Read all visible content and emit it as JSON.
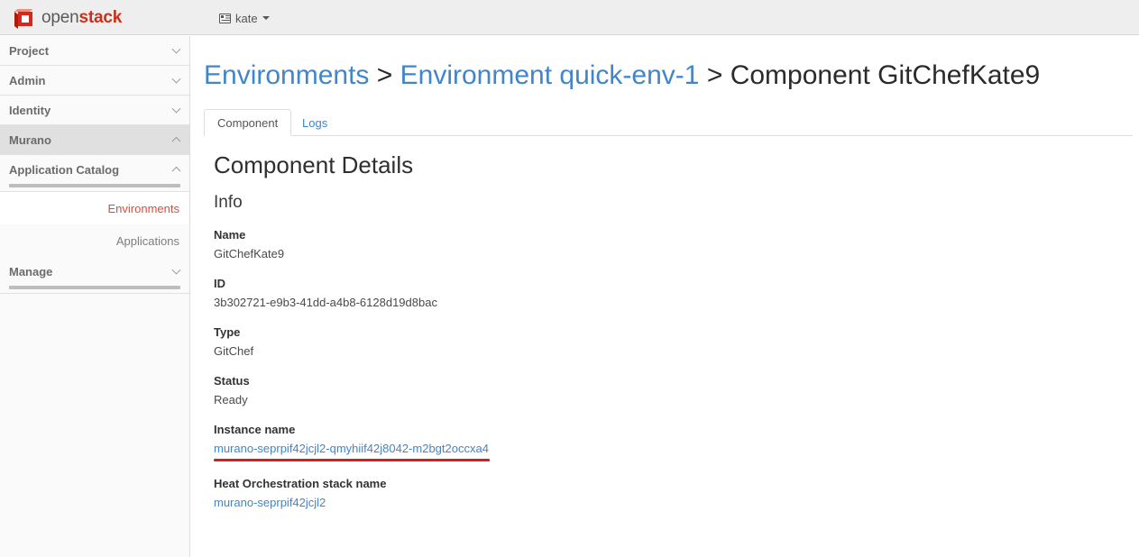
{
  "navbar": {
    "brand_open": "open",
    "brand_stack": "stack",
    "brand_logo_icon": "openstack-cube-icon",
    "user_icon": "id-card-icon",
    "user_name": "kate",
    "caret_icon": "caret-down-icon"
  },
  "sidebar": {
    "groups": [
      {
        "label": "Project",
        "state": "collapsed",
        "chevron": "chevron-down-icon"
      },
      {
        "label": "Admin",
        "state": "collapsed",
        "chevron": "chevron-down-icon"
      },
      {
        "label": "Identity",
        "state": "collapsed",
        "chevron": "chevron-down-icon"
      },
      {
        "label": "Murano",
        "state": "expanded",
        "chevron": "chevron-up-icon"
      },
      {
        "label": "Application Catalog",
        "state": "expanded",
        "chevron": "chevron-up-icon"
      },
      {
        "label": "Manage",
        "state": "collapsed",
        "chevron": "chevron-down-icon"
      }
    ],
    "items": [
      {
        "label": "Environments",
        "current": true
      },
      {
        "label": "Applications",
        "current": false
      }
    ]
  },
  "breadcrumb": {
    "root": "Environments",
    "sep": ">",
    "environment": "Environment quick-env-1",
    "current": "Component GitChefKate9"
  },
  "tabs": [
    {
      "label": "Component",
      "active": true
    },
    {
      "label": "Logs",
      "active": false
    }
  ],
  "details": {
    "title": "Component Details",
    "section": "Info",
    "fields": [
      {
        "label": "Name",
        "value": "GitChefKate9"
      },
      {
        "label": "ID",
        "value": "3b302721-e9b3-41dd-a4b8-6128d19d8bac"
      },
      {
        "label": "Type",
        "value": "GitChef"
      },
      {
        "label": "Status",
        "value": "Ready"
      },
      {
        "label": "Instance name",
        "value": "murano-seprpif42jcjl2-qmyhiif42j8042-m2bgt2occxa4"
      },
      {
        "label": "Heat Orchestration stack name",
        "value": "murano-seprpif42jcjl2"
      }
    ]
  },
  "colors": {
    "brand_red": "#cf2f19",
    "link_blue": "#4285c9",
    "active_nav_red": "#d94e3a",
    "annotation_red": "#cc2222",
    "navbar_bg": "#eeeeee",
    "sidebar_bg": "#fafafa"
  }
}
